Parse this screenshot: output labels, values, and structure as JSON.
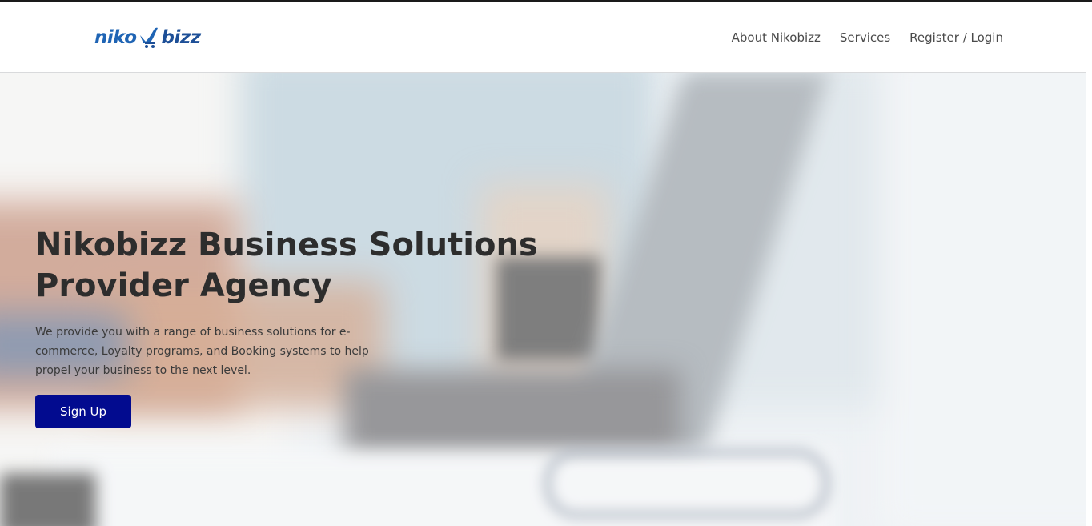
{
  "brand": {
    "logo_part1": "niko",
    "logo_part2": "bizz",
    "logo_icon": "shopping-cart-bird-icon",
    "colors": {
      "primary": "#1f64b4",
      "button": "#020b8f"
    }
  },
  "nav": {
    "items": [
      {
        "label": "About Nikobizz"
      },
      {
        "label": "Services"
      },
      {
        "label": "Register / Login"
      }
    ]
  },
  "hero": {
    "title": "Nikobizz Business Solutions Provider Agency",
    "description": "We provide you with a range of business solutions for e-commerce, Loyalty programs, and Booking systems to help propel your business to the next level.",
    "cta_label": "Sign Up",
    "background": "blurred-laptop-coffee-photo"
  }
}
